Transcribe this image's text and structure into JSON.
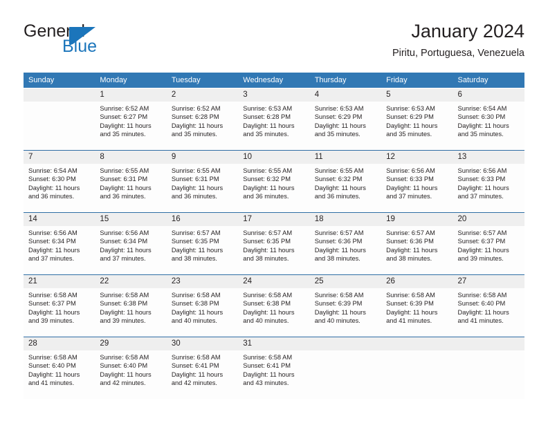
{
  "brand": {
    "name_part1": "General",
    "name_part2": "Blue",
    "mark": "blue-sail-triangle",
    "color_dark": "#231f20",
    "color_blue": "#1b75bb"
  },
  "header": {
    "title": "January 2024",
    "subtitle": "Piritu, Portuguesa, Venezuela"
  },
  "theme": {
    "header_blue": "#3178b4",
    "row_separator_blue": "#2e6da4",
    "daynum_band": "#efefef",
    "cell_background": "#fdfdfd",
    "text": "#231f20"
  },
  "calendar": {
    "weekday_headers": [
      "Sunday",
      "Monday",
      "Tuesday",
      "Wednesday",
      "Thursday",
      "Friday",
      "Saturday"
    ],
    "weeks": [
      [
        {
          "day": "",
          "sunrise": "",
          "sunset": "",
          "daylight_line1": "",
          "daylight_line2": ""
        },
        {
          "day": "1",
          "sunrise": "Sunrise: 6:52 AM",
          "sunset": "Sunset: 6:27 PM",
          "daylight_line1": "Daylight: 11 hours",
          "daylight_line2": "and 35 minutes."
        },
        {
          "day": "2",
          "sunrise": "Sunrise: 6:52 AM",
          "sunset": "Sunset: 6:28 PM",
          "daylight_line1": "Daylight: 11 hours",
          "daylight_line2": "and 35 minutes."
        },
        {
          "day": "3",
          "sunrise": "Sunrise: 6:53 AM",
          "sunset": "Sunset: 6:28 PM",
          "daylight_line1": "Daylight: 11 hours",
          "daylight_line2": "and 35 minutes."
        },
        {
          "day": "4",
          "sunrise": "Sunrise: 6:53 AM",
          "sunset": "Sunset: 6:29 PM",
          "daylight_line1": "Daylight: 11 hours",
          "daylight_line2": "and 35 minutes."
        },
        {
          "day": "5",
          "sunrise": "Sunrise: 6:53 AM",
          "sunset": "Sunset: 6:29 PM",
          "daylight_line1": "Daylight: 11 hours",
          "daylight_line2": "and 35 minutes."
        },
        {
          "day": "6",
          "sunrise": "Sunrise: 6:54 AM",
          "sunset": "Sunset: 6:30 PM",
          "daylight_line1": "Daylight: 11 hours",
          "daylight_line2": "and 35 minutes."
        }
      ],
      [
        {
          "day": "7",
          "sunrise": "Sunrise: 6:54 AM",
          "sunset": "Sunset: 6:30 PM",
          "daylight_line1": "Daylight: 11 hours",
          "daylight_line2": "and 36 minutes."
        },
        {
          "day": "8",
          "sunrise": "Sunrise: 6:55 AM",
          "sunset": "Sunset: 6:31 PM",
          "daylight_line1": "Daylight: 11 hours",
          "daylight_line2": "and 36 minutes."
        },
        {
          "day": "9",
          "sunrise": "Sunrise: 6:55 AM",
          "sunset": "Sunset: 6:31 PM",
          "daylight_line1": "Daylight: 11 hours",
          "daylight_line2": "and 36 minutes."
        },
        {
          "day": "10",
          "sunrise": "Sunrise: 6:55 AM",
          "sunset": "Sunset: 6:32 PM",
          "daylight_line1": "Daylight: 11 hours",
          "daylight_line2": "and 36 minutes."
        },
        {
          "day": "11",
          "sunrise": "Sunrise: 6:55 AM",
          "sunset": "Sunset: 6:32 PM",
          "daylight_line1": "Daylight: 11 hours",
          "daylight_line2": "and 36 minutes."
        },
        {
          "day": "12",
          "sunrise": "Sunrise: 6:56 AM",
          "sunset": "Sunset: 6:33 PM",
          "daylight_line1": "Daylight: 11 hours",
          "daylight_line2": "and 37 minutes."
        },
        {
          "day": "13",
          "sunrise": "Sunrise: 6:56 AM",
          "sunset": "Sunset: 6:33 PM",
          "daylight_line1": "Daylight: 11 hours",
          "daylight_line2": "and 37 minutes."
        }
      ],
      [
        {
          "day": "14",
          "sunrise": "Sunrise: 6:56 AM",
          "sunset": "Sunset: 6:34 PM",
          "daylight_line1": "Daylight: 11 hours",
          "daylight_line2": "and 37 minutes."
        },
        {
          "day": "15",
          "sunrise": "Sunrise: 6:56 AM",
          "sunset": "Sunset: 6:34 PM",
          "daylight_line1": "Daylight: 11 hours",
          "daylight_line2": "and 37 minutes."
        },
        {
          "day": "16",
          "sunrise": "Sunrise: 6:57 AM",
          "sunset": "Sunset: 6:35 PM",
          "daylight_line1": "Daylight: 11 hours",
          "daylight_line2": "and 38 minutes."
        },
        {
          "day": "17",
          "sunrise": "Sunrise: 6:57 AM",
          "sunset": "Sunset: 6:35 PM",
          "daylight_line1": "Daylight: 11 hours",
          "daylight_line2": "and 38 minutes."
        },
        {
          "day": "18",
          "sunrise": "Sunrise: 6:57 AM",
          "sunset": "Sunset: 6:36 PM",
          "daylight_line1": "Daylight: 11 hours",
          "daylight_line2": "and 38 minutes."
        },
        {
          "day": "19",
          "sunrise": "Sunrise: 6:57 AM",
          "sunset": "Sunset: 6:36 PM",
          "daylight_line1": "Daylight: 11 hours",
          "daylight_line2": "and 38 minutes."
        },
        {
          "day": "20",
          "sunrise": "Sunrise: 6:57 AM",
          "sunset": "Sunset: 6:37 PM",
          "daylight_line1": "Daylight: 11 hours",
          "daylight_line2": "and 39 minutes."
        }
      ],
      [
        {
          "day": "21",
          "sunrise": "Sunrise: 6:58 AM",
          "sunset": "Sunset: 6:37 PM",
          "daylight_line1": "Daylight: 11 hours",
          "daylight_line2": "and 39 minutes."
        },
        {
          "day": "22",
          "sunrise": "Sunrise: 6:58 AM",
          "sunset": "Sunset: 6:38 PM",
          "daylight_line1": "Daylight: 11 hours",
          "daylight_line2": "and 39 minutes."
        },
        {
          "day": "23",
          "sunrise": "Sunrise: 6:58 AM",
          "sunset": "Sunset: 6:38 PM",
          "daylight_line1": "Daylight: 11 hours",
          "daylight_line2": "and 40 minutes."
        },
        {
          "day": "24",
          "sunrise": "Sunrise: 6:58 AM",
          "sunset": "Sunset: 6:38 PM",
          "daylight_line1": "Daylight: 11 hours",
          "daylight_line2": "and 40 minutes."
        },
        {
          "day": "25",
          "sunrise": "Sunrise: 6:58 AM",
          "sunset": "Sunset: 6:39 PM",
          "daylight_line1": "Daylight: 11 hours",
          "daylight_line2": "and 40 minutes."
        },
        {
          "day": "26",
          "sunrise": "Sunrise: 6:58 AM",
          "sunset": "Sunset: 6:39 PM",
          "daylight_line1": "Daylight: 11 hours",
          "daylight_line2": "and 41 minutes."
        },
        {
          "day": "27",
          "sunrise": "Sunrise: 6:58 AM",
          "sunset": "Sunset: 6:40 PM",
          "daylight_line1": "Daylight: 11 hours",
          "daylight_line2": "and 41 minutes."
        }
      ],
      [
        {
          "day": "28",
          "sunrise": "Sunrise: 6:58 AM",
          "sunset": "Sunset: 6:40 PM",
          "daylight_line1": "Daylight: 11 hours",
          "daylight_line2": "and 41 minutes."
        },
        {
          "day": "29",
          "sunrise": "Sunrise: 6:58 AM",
          "sunset": "Sunset: 6:40 PM",
          "daylight_line1": "Daylight: 11 hours",
          "daylight_line2": "and 42 minutes."
        },
        {
          "day": "30",
          "sunrise": "Sunrise: 6:58 AM",
          "sunset": "Sunset: 6:41 PM",
          "daylight_line1": "Daylight: 11 hours",
          "daylight_line2": "and 42 minutes."
        },
        {
          "day": "31",
          "sunrise": "Sunrise: 6:58 AM",
          "sunset": "Sunset: 6:41 PM",
          "daylight_line1": "Daylight: 11 hours",
          "daylight_line2": "and 43 minutes."
        },
        {
          "day": "",
          "sunrise": "",
          "sunset": "",
          "daylight_line1": "",
          "daylight_line2": ""
        },
        {
          "day": "",
          "sunrise": "",
          "sunset": "",
          "daylight_line1": "",
          "daylight_line2": ""
        },
        {
          "day": "",
          "sunrise": "",
          "sunset": "",
          "daylight_line1": "",
          "daylight_line2": ""
        }
      ]
    ]
  }
}
